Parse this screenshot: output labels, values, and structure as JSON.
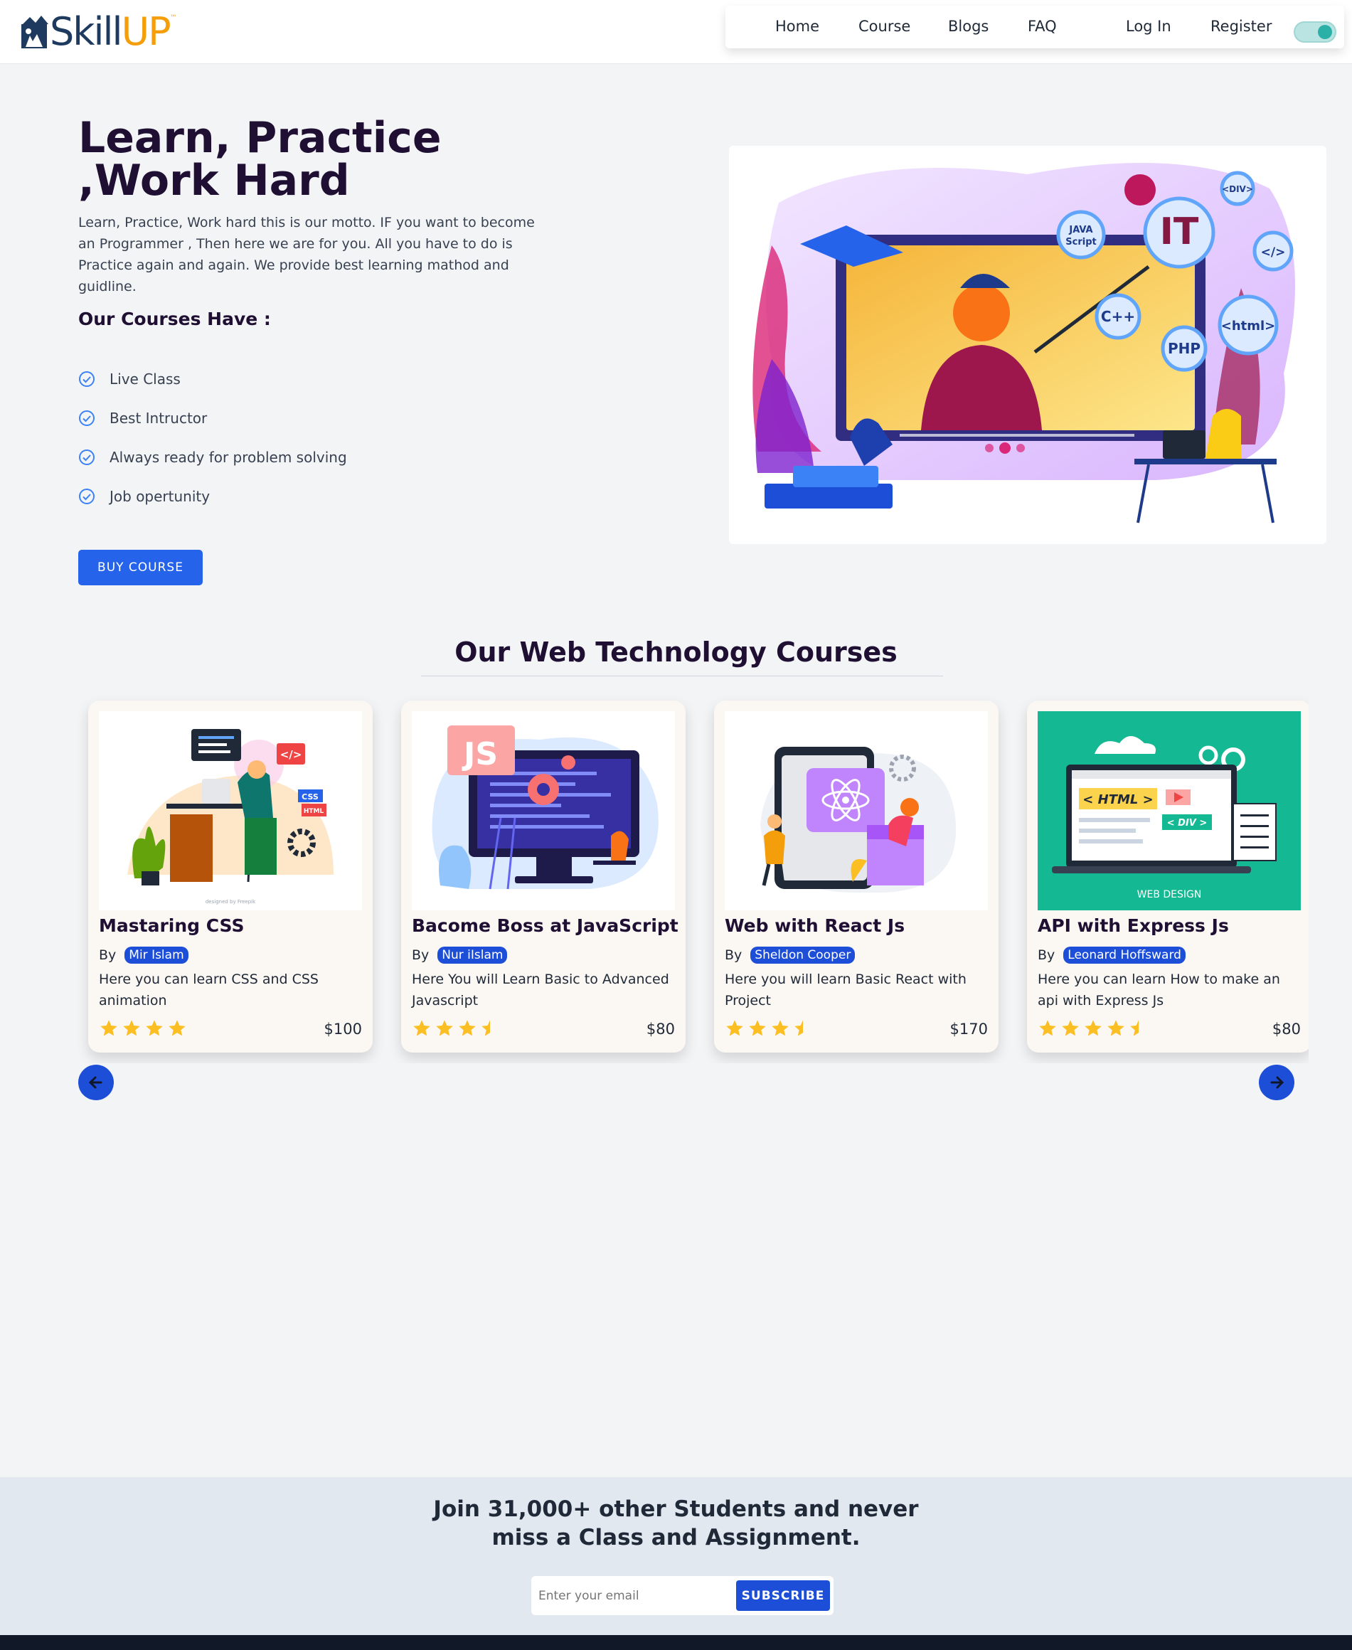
{
  "header": {
    "logo_main": "Skill",
    "logo_accent": "UP",
    "nav": [
      "Home",
      "Course",
      "Blogs",
      "FAQ"
    ],
    "login_label": "Log In",
    "register_label": "Register"
  },
  "hero": {
    "title_line1": "Learn, Practice",
    "title_line2": ",Work Hard",
    "description": "Learn, Practice, Work hard this is our motto. IF you want to become an Programmer , Then here we are for you. All you have to do is Practice again and again. We provide best learning mathod and guidline.",
    "subheading": "Our Courses Have :",
    "features": [
      "Live Class",
      "Best Intructor",
      "Always ready for problem solving",
      "Job opertunity"
    ],
    "buy_label": "BUY COURSE",
    "illustration_labels": {
      "it": "IT",
      "div": "<DIV>",
      "js_line1": "JAVA",
      "js_line2": "Script",
      "tag": "</>",
      "cpp": "C++",
      "php": "PHP",
      "html": "<html>"
    }
  },
  "courses_section": {
    "title": "Our Web Technology Courses",
    "courses": [
      {
        "title": "Mastaring CSS",
        "by": "By",
        "author": "Mir Islam",
        "description": "Here you can learn CSS and CSS animation",
        "rating": 4,
        "price": "$100",
        "img_labels": [
          "</>",
          "CSS",
          "HTML"
        ],
        "img_credit": "designed by Freepik"
      },
      {
        "title": "Bacome Boss at JavaScript",
        "by": "By",
        "author": "Nur iIslam",
        "description": "Here You will Learn Basic to Advanced Javascript",
        "rating": 3.5,
        "price": "$80",
        "img_labels": [
          "JS"
        ]
      },
      {
        "title": "Web with React Js",
        "by": "By",
        "author": "Sheldon Cooper",
        "description": "Here you will learn Basic React with Project",
        "rating": 3.5,
        "price": "$170"
      },
      {
        "title": "API with Express Js",
        "by": "By",
        "author": "Leonard Hoffsward",
        "description": "Here you can learn How to make an api with Express Js",
        "rating": 4.5,
        "price": "$80",
        "img_labels": [
          "< HTML >",
          "< DIV >",
          "WEB DESIGN"
        ]
      }
    ]
  },
  "newsletter": {
    "title_line1": "Join 31,000+ other Students and never",
    "title_line2": "miss a Class and Assignment.",
    "email_placeholder": "Enter your email",
    "subscribe_label": "SUBSCRIBE"
  },
  "colors": {
    "primary": "#2563eb",
    "dark_heading": "#1f0f33",
    "logo_blue": "#1e3a5f",
    "logo_orange": "#f59e0b",
    "star": "#fbbf24",
    "page_bg": "#f3f4f6"
  }
}
